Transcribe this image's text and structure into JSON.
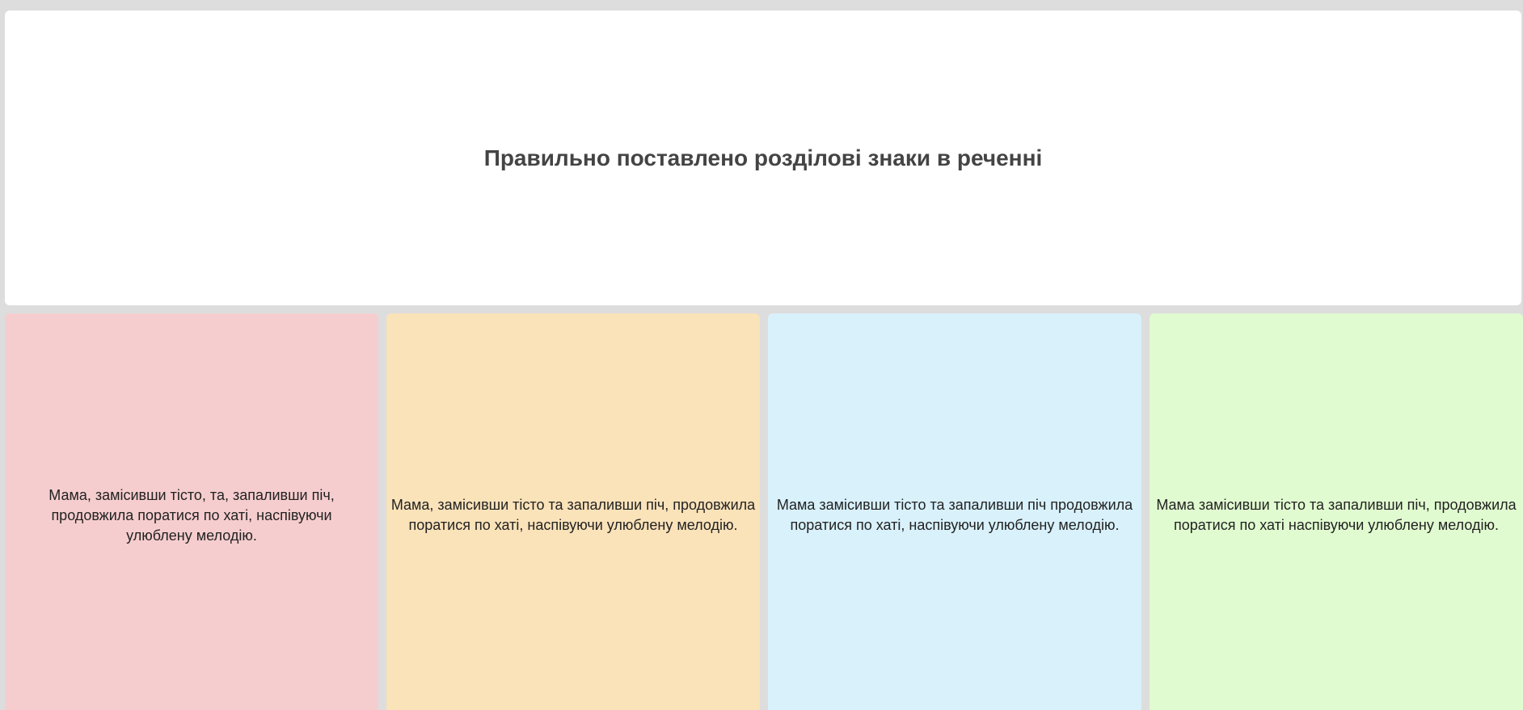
{
  "question": {
    "text": "Правильно поставлено розділові знаки в реченні"
  },
  "answers": [
    {
      "text": "Мама, замісивши тісто, та, запаливши піч, продовжила поратися по хаті, наспівуючи улюблену мелодію.",
      "color": "#f6cdce"
    },
    {
      "text": "Мама, замісивши тісто та запаливши піч, продовжила поратися по хаті, наспівуючи улюблену мелодію.",
      "color": "#fae2b9"
    },
    {
      "text": "Мама замісивши тісто та запаливши піч продовжила поратися по хаті, наспівуючи улюблену мелодію.",
      "color": "#d8f1fb"
    },
    {
      "text": "Мама замісивши тісто та запаливши піч, продовжила поратися по хаті наспівуючи улюблену мелодію.",
      "color": "#e1fbd0"
    }
  ]
}
